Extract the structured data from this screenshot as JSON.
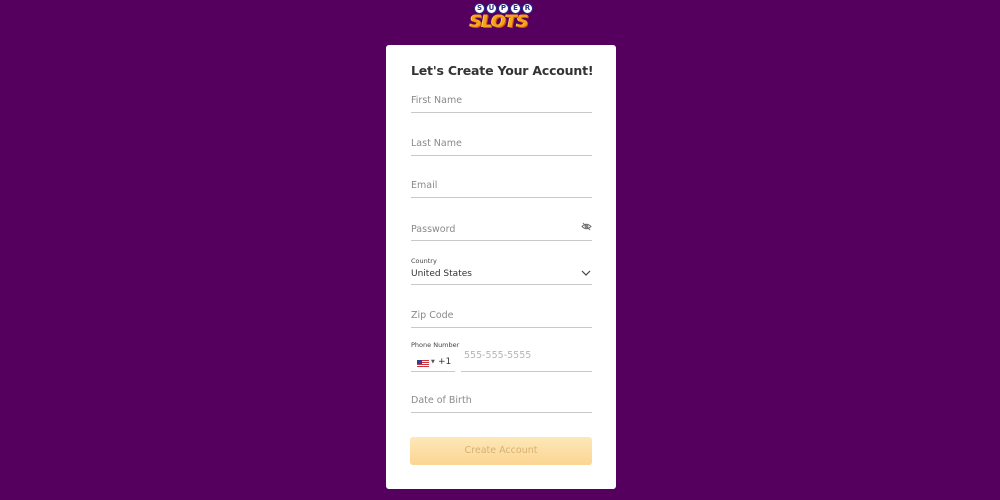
{
  "logo": {
    "top_letters": [
      "S",
      "U",
      "P",
      "E",
      "R"
    ],
    "bottom_text": "SLOTS"
  },
  "form": {
    "title": "Let's Create Your Account!",
    "first_name": {
      "placeholder": "First Name"
    },
    "last_name": {
      "placeholder": "Last Name"
    },
    "email": {
      "placeholder": "Email"
    },
    "password": {
      "placeholder": "Password",
      "toggle_icon": "eye-slash-icon"
    },
    "country": {
      "label": "Country",
      "value": "United States",
      "icon": "chevron-down-icon"
    },
    "zip": {
      "placeholder": "Zip Code"
    },
    "phone": {
      "label": "Phone Number",
      "flag_icon": "us-flag-icon",
      "dial_code": "+1",
      "placeholder": "555-555-5555"
    },
    "dob": {
      "placeholder": "Date of Birth"
    },
    "submit_label": "Create Account"
  },
  "colors": {
    "background": "#55005f",
    "card": "#ffffff",
    "button_gradient_top": "#fde8b9",
    "button_gradient_bottom": "#fbd591",
    "button_text": "#d8b071",
    "logo_orange": "#f7a21b",
    "logo_blue": "#2b2e8a"
  }
}
